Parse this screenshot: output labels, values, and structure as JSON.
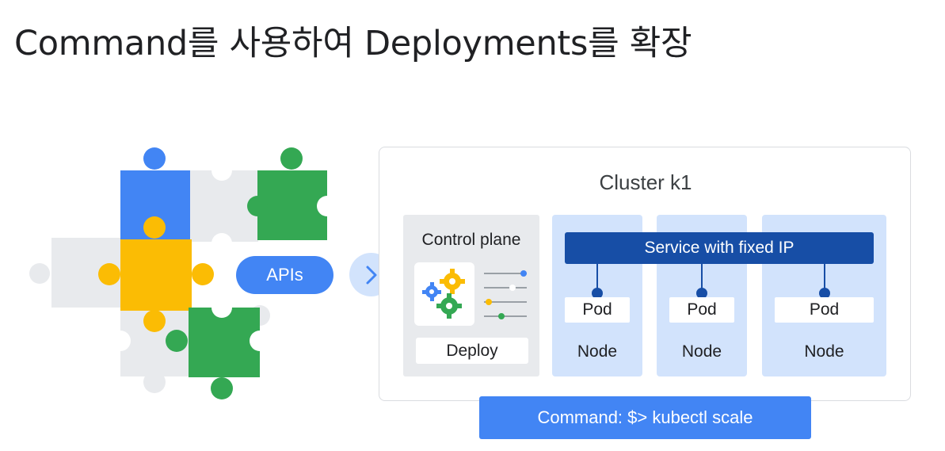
{
  "title": "Command를 사용하여 Deployments를 확장",
  "apis_label": "APIs",
  "cluster": {
    "title": "Cluster k1",
    "control_plane": {
      "title": "Control plane",
      "deploy_label": "Deploy"
    },
    "service_label": "Service with fixed IP",
    "nodes": [
      {
        "pod_label": "Pod",
        "node_label": "Node"
      },
      {
        "pod_label": "Pod",
        "node_label": "Node"
      },
      {
        "pod_label": "Pod",
        "node_label": "Node"
      }
    ]
  },
  "command_label": "Command: $> kubectl scale",
  "colors": {
    "blue": "#4285f4",
    "dark_blue": "#174ea6",
    "light_blue": "#d2e3fc",
    "green": "#34a853",
    "yellow": "#fbbc04",
    "light_gray": "#e8eaed"
  },
  "icons": [
    "puzzle-icon",
    "chevron-right-icon",
    "gears-icon",
    "sliders-icon"
  ]
}
